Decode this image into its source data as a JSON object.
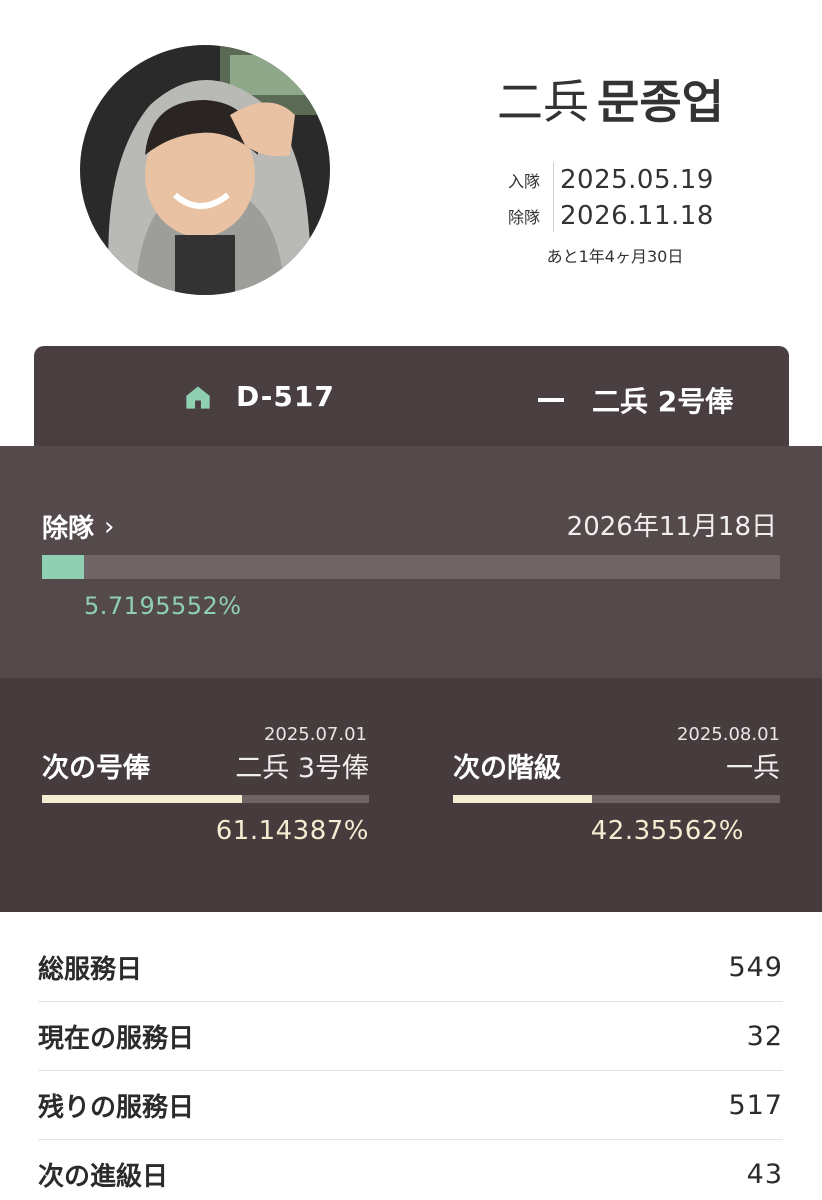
{
  "profile": {
    "rank": "二兵",
    "name": "문종업",
    "enlist_label": "入隊",
    "enlist_date": "2025.05.19",
    "discharge_label": "除隊",
    "discharge_date": "2026.11.18",
    "remaining_text": "あと1年4ヶ月30日"
  },
  "topbar": {
    "dday": "D-517",
    "current_rank": "二兵 2号俸"
  },
  "discharge": {
    "title": "除隊",
    "date": "2026年11月18日",
    "percent_text": "5.7195552%",
    "progress": 0.057195552
  },
  "next_pay": {
    "date": "2025.07.01",
    "title": "次の号俸",
    "rank": "二兵 3号俸",
    "percent_text": "61.14387%",
    "progress": 0.6114387
  },
  "next_rank": {
    "date": "2025.08.01",
    "title": "次の階級",
    "rank": "一兵",
    "percent_text": "42.35562%",
    "progress": 0.4235562
  },
  "stats": [
    {
      "label": "総服務日",
      "value": "549"
    },
    {
      "label": "現在の服務日",
      "value": "32"
    },
    {
      "label": "残りの服務日",
      "value": "517"
    },
    {
      "label": "次の進級日",
      "value": "43"
    }
  ],
  "colors": {
    "accent_green": "#8fcfb2",
    "accent_cream": "#f6ecd1",
    "dark_bar": "#4a3f40",
    "dark_panel": "#544a4b",
    "darker_panel": "#463c3d"
  },
  "icons": {
    "home": "home-icon",
    "rank_private": "rank-bar-icon",
    "chevron": "chevron-right-icon"
  }
}
